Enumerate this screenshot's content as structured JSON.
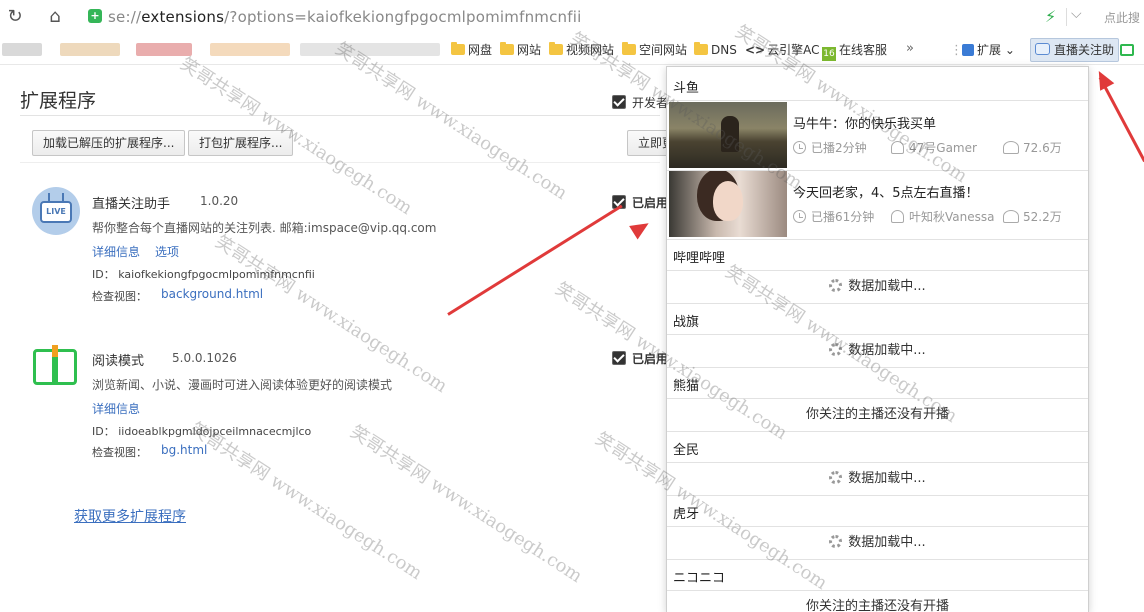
{
  "browser": {
    "url_prefix": "se://",
    "url_host": "extensions",
    "url_rest": "/?options=kaiofkekiongfpgocmlpomimfnmcnfii",
    "search_hint": "点此搜"
  },
  "bookmarks": {
    "items": [
      "网盘",
      "网站",
      "视频网站",
      "空间网站",
      "DNS",
      "云引擎AC",
      "在线客服"
    ],
    "more": "»",
    "ext_label": "扩展",
    "active_ext": "直播关注助"
  },
  "page": {
    "title": "扩展程序",
    "dev_mode": "开发者",
    "load_unpacked": "加载已解压的扩展程序...",
    "pack": "打包扩展程序...",
    "update_now": "立即更",
    "more_extensions": "获取更多扩展程序"
  },
  "extensions": [
    {
      "icon": "tv-live-icon",
      "name": "直播关注助手",
      "version": "1.0.20",
      "description": "帮你整合每个直播网站的关注列表. 邮箱:imspace@vip.qq.com",
      "details": "详细信息",
      "options": "选项",
      "id_label": "ID：",
      "id": "kaiofkekiongfpgocmlpomimfnmcnfii",
      "view_label": "检查视图：",
      "view": "background.html",
      "enabled": "已启用"
    },
    {
      "icon": "book-icon",
      "name": "阅读模式",
      "version": "5.0.0.1026",
      "description": "浏览新闻、小说、漫画时可进入阅读体验更好的阅读模式",
      "details": "详细信息",
      "id_label": "ID：",
      "id": "iidoeablkpgmldojpceilmnacecmjlco",
      "view_label": "检查视图：",
      "view": "bg.html",
      "enabled": "已启用"
    }
  ],
  "popup": {
    "sections": [
      {
        "name": "斗鱼"
      },
      {
        "name": "哔哩哔哩",
        "status": "数据加载中..."
      },
      {
        "name": "战旗",
        "status": "数据加载中..."
      },
      {
        "name": "熊猫",
        "status": "你关注的主播还没有开播"
      },
      {
        "name": "全民",
        "status": "数据加载中..."
      },
      {
        "name": "虎牙",
        "status": "数据加载中..."
      },
      {
        "name": "ニコニコ",
        "status": "你关注的主播还没有开播"
      }
    ],
    "streams": [
      {
        "title": "马牛牛：你的快乐我买单",
        "time": "已播2分钟",
        "streamer": "47号Gamer",
        "viewers": "72.6万"
      },
      {
        "title": "今天回老家，4、5点左右直播！",
        "time": "已播61分钟",
        "streamer": "叶知秋Vanessa",
        "viewers": "52.2万"
      }
    ]
  },
  "watermark": {
    "text": "笑哥共享网",
    "url": "www.xiaogegh.com"
  },
  "colors": {
    "arrow": "#e03a3a",
    "link": "#3b6fbf",
    "accent_green": "#2fbf4f"
  }
}
